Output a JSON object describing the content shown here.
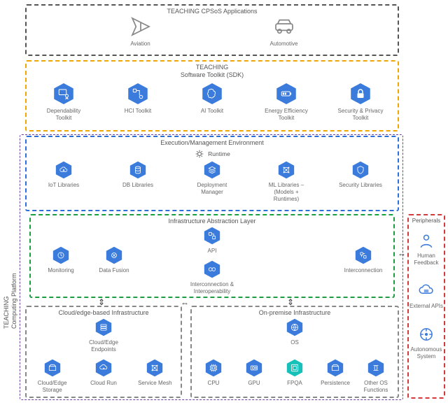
{
  "sideLabel": {
    "line1": "TEACHING",
    "line2": "Computing Platform"
  },
  "apps": {
    "title": "TEACHING CPSoS Applications",
    "items": [
      {
        "name": "aviation",
        "label": "Aviation",
        "icon": "airplane-icon"
      },
      {
        "name": "automotive",
        "label": "Automotive",
        "icon": "car-icon"
      }
    ]
  },
  "sdk": {
    "title1": "TEACHING",
    "title2": "Software Toolkit (SDK)",
    "items": [
      {
        "name": "dependability-toolkit",
        "label": "Dependability Toolkit",
        "icon": "certificate-icon"
      },
      {
        "name": "hci-toolkit",
        "label": "HCI Toolkit",
        "icon": "flow-icon"
      },
      {
        "name": "ai-toolkit",
        "label": "AI Toolkit",
        "icon": "brain-icon"
      },
      {
        "name": "energy-toolkit",
        "label": "Energy Efficiency Toolkit",
        "icon": "battery-icon"
      },
      {
        "name": "security-privacy-toolkit",
        "label": "Security & Privacy Toolkit",
        "icon": "padlock-icon"
      }
    ]
  },
  "env": {
    "title": "Execution/Management Environment",
    "runtimeLabel": "Runtime",
    "items": [
      {
        "name": "iot-libraries",
        "label": "IoT Libraries",
        "icon": "cloud-upload-icon"
      },
      {
        "name": "db-libraries",
        "label": "DB Libraries",
        "icon": "database-icon"
      },
      {
        "name": "deployment-manager",
        "label": "Deployment Manager",
        "icon": "deployment-icon"
      },
      {
        "name": "ml-libraries",
        "label": "ML Libraries – (Models + Runtimes)",
        "icon": "network-icon"
      },
      {
        "name": "security-libraries",
        "label": "Security Libraries",
        "icon": "shield-icon"
      }
    ]
  },
  "abstraction": {
    "title": "Infrastructure Abstraction Layer",
    "top": {
      "name": "api",
      "label": "API",
      "icon": "api-icon"
    },
    "left": [
      {
        "name": "monitoring",
        "label": "Monitoring",
        "icon": "monitor-icon"
      },
      {
        "name": "data-fusion",
        "label": "Data Fusion",
        "icon": "fusion-icon"
      }
    ],
    "right": {
      "name": "interconnection",
      "label": "Interconnection",
      "icon": "interconnection-icon"
    },
    "bottom": {
      "name": "interop",
      "label": "Interconnection & Interoperability",
      "icon": "interop-icon"
    }
  },
  "cloud": {
    "title": "Cloud/edge-based Infrastructure",
    "top": {
      "name": "cloud-edge-endpoints",
      "label": "Cloud/Edge Endpoints",
      "icon": "servers-icon"
    },
    "bottom": [
      {
        "name": "cloud-edge-storage",
        "label": "Cloud/Edge Storage",
        "icon": "storage-icon"
      },
      {
        "name": "cloud-run",
        "label": "Cloud Run",
        "icon": "cloud-run-icon"
      },
      {
        "name": "service-mesh",
        "label": "Service Mesh",
        "icon": "mesh-icon"
      }
    ]
  },
  "onprem": {
    "title": "On-premise Infrastructure",
    "top": {
      "name": "os",
      "label": "OS",
      "icon": "os-icon"
    },
    "bottom": [
      {
        "name": "cpu",
        "label": "CPU",
        "icon": "cpu-icon"
      },
      {
        "name": "gpu",
        "label": "GPU",
        "icon": "gpu-icon"
      },
      {
        "name": "fpga",
        "label": "FPQA",
        "icon": "fpga-icon"
      },
      {
        "name": "persistence",
        "label": "Persistence",
        "icon": "persistence-icon"
      },
      {
        "name": "other-os-fn",
        "label": "Other OS Functions",
        "icon": "functions-icon"
      }
    ]
  },
  "peripherals": {
    "title": "Peripherals",
    "items": [
      {
        "name": "human-feedback",
        "label": "Human Feedback",
        "icon": "human-icon"
      },
      {
        "name": "external-apis",
        "label": "External APIs",
        "icon": "cloud-api-icon"
      },
      {
        "name": "autonomous-system",
        "label": "Autonomous System",
        "icon": "autonomous-icon"
      }
    ]
  }
}
